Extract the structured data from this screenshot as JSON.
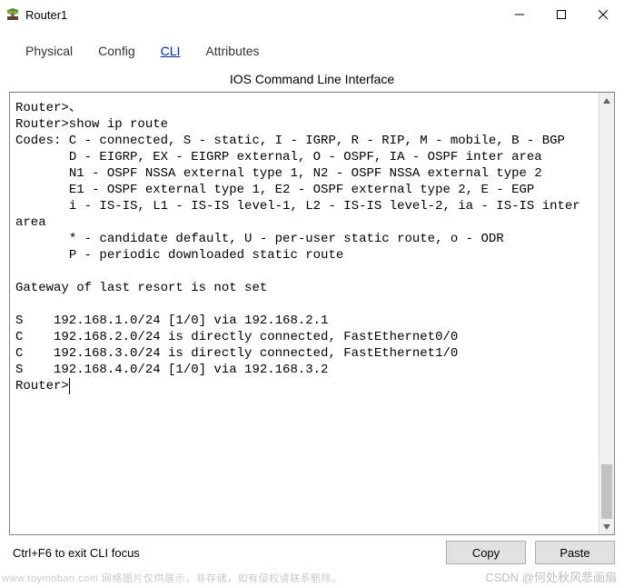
{
  "window": {
    "title": "Router1"
  },
  "tabs": [
    {
      "label": "Physical",
      "active": false
    },
    {
      "label": "Config",
      "active": false
    },
    {
      "label": "CLI",
      "active": true
    },
    {
      "label": "Attributes",
      "active": false
    }
  ],
  "panel_title": "IOS Command Line Interface",
  "terminal_output": "Router>、\nRouter>show ip route\nCodes: C - connected, S - static, I - IGRP, R - RIP, M - mobile, B - BGP\n       D - EIGRP, EX - EIGRP external, O - OSPF, IA - OSPF inter area\n       N1 - OSPF NSSA external type 1, N2 - OSPF NSSA external type 2\n       E1 - OSPF external type 1, E2 - OSPF external type 2, E - EGP\n       i - IS-IS, L1 - IS-IS level-1, L2 - IS-IS level-2, ia - IS-IS inter area\n       * - candidate default, U - per-user static route, o - ODR\n       P - periodic downloaded static route\n\nGateway of last resort is not set\n\nS    192.168.1.0/24 [1/0] via 192.168.2.1\nC    192.168.2.0/24 is directly connected, FastEthernet0/0\nC    192.168.3.0/24 is directly connected, FastEthernet1/0\nS    192.168.4.0/24 [1/0] via 192.168.3.2\n",
  "prompt": "Router>",
  "footer": {
    "hint": "Ctrl+F6 to exit CLI focus",
    "copy": "Copy",
    "paste": "Paste"
  },
  "watermark_left": "www.toymoban.com  网络图片仅供展示，非存储，如有侵权请联系删除。",
  "watermark_right": "CSDN @何处秋风悲画扇"
}
